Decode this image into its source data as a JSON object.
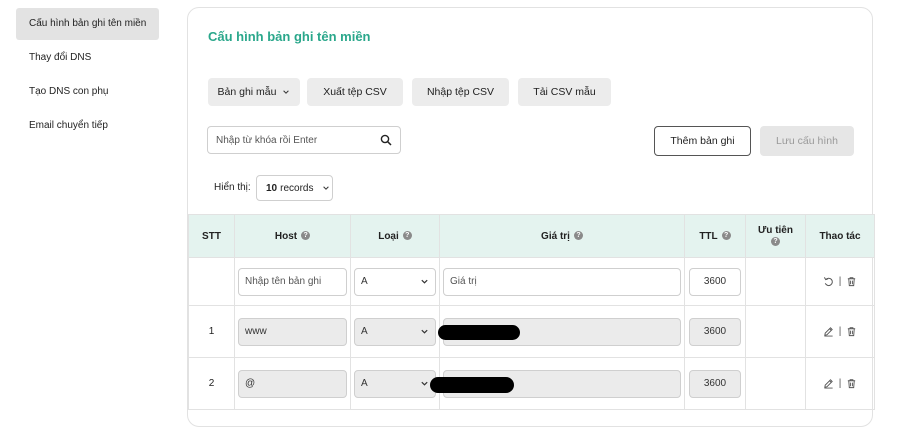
{
  "sidebar": {
    "items": [
      {
        "label": "Cấu hình bản ghi tên miền",
        "active": true
      },
      {
        "label": "Thay đổi DNS",
        "active": false
      },
      {
        "label": "Tạo DNS con phụ",
        "active": false
      },
      {
        "label": "Email chuyển tiếp",
        "active": false
      }
    ]
  },
  "page": {
    "title": "Cấu hình bản ghi tên miền",
    "accent_color": "#2aa78b"
  },
  "toolbar": {
    "template_label": "Bản ghi mẫu",
    "export_label": "Xuất tệp CSV",
    "import_label": "Nhập tệp CSV",
    "download_label": "Tải CSV mẫu",
    "search_placeholder": "Nhập từ khóa rồi Enter",
    "add_label": "Thêm bản ghi",
    "save_label": "Lưu cấu hình"
  },
  "pagination": {
    "show_label": "Hiển thị:",
    "records_count": "10",
    "records_unit": "records"
  },
  "table": {
    "headers": {
      "stt": "STT",
      "host": "Host",
      "type": "Loại",
      "value": "Giá trị",
      "ttl": "TTL",
      "priority": "Ưu tiên",
      "actions": "Thao tác"
    },
    "new_row": {
      "host_placeholder": "Nhập tên bản ghi",
      "type": "A",
      "value_placeholder": "Giá trị",
      "ttl": "3600"
    },
    "rows": [
      {
        "stt": "1",
        "host": "www",
        "type": "A",
        "ttl": "3600"
      },
      {
        "stt": "2",
        "host": "@",
        "type": "A",
        "ttl": "3600"
      }
    ]
  }
}
